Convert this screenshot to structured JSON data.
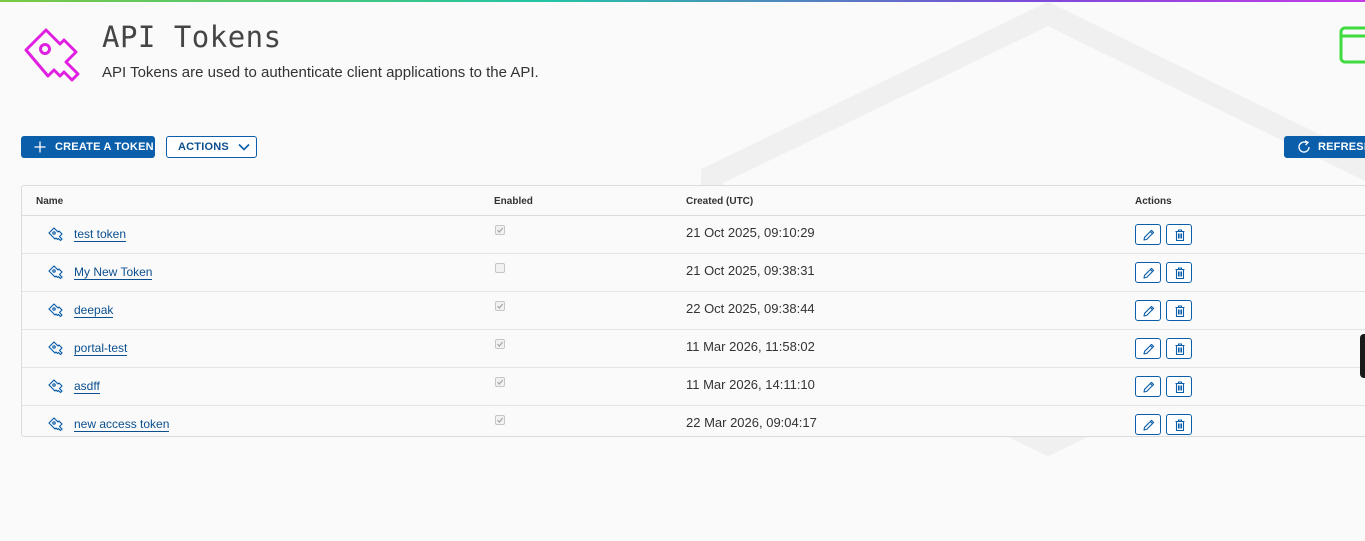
{
  "header": {
    "title": "API Tokens",
    "subtitle": "API Tokens are used to authenticate client applications to the API.",
    "icon": "key-icon"
  },
  "toolbar": {
    "create_label": "CREATE A TOKEN",
    "actions_label": "ACTIONS",
    "refresh_label": "REFRESH"
  },
  "table": {
    "columns": [
      "Name",
      "Enabled",
      "Created (UTC)",
      "Actions"
    ],
    "rows": [
      {
        "name": "test token",
        "enabled": true,
        "created": "21 Oct 2025, 09:10:29"
      },
      {
        "name": "My New Token",
        "enabled": false,
        "created": "21 Oct 2025, 09:38:31"
      },
      {
        "name": "deepak",
        "enabled": true,
        "created": "22 Oct 2025, 09:38:44"
      },
      {
        "name": "portal-test",
        "enabled": true,
        "created": "11 Mar 2026, 11:58:02"
      },
      {
        "name": "asdff",
        "enabled": true,
        "created": "11 Mar 2026, 14:11:10"
      },
      {
        "name": "new access token",
        "enabled": true,
        "created": "22 Mar 2026, 09:04:17"
      }
    ],
    "row_actions": [
      "edit-icon",
      "trash-icon"
    ]
  },
  "colors": {
    "primary": "#0b5eaa",
    "link": "#0b4f8f",
    "header_icon": "#e020e0",
    "top_right_icon": "#3fdc3f"
  }
}
